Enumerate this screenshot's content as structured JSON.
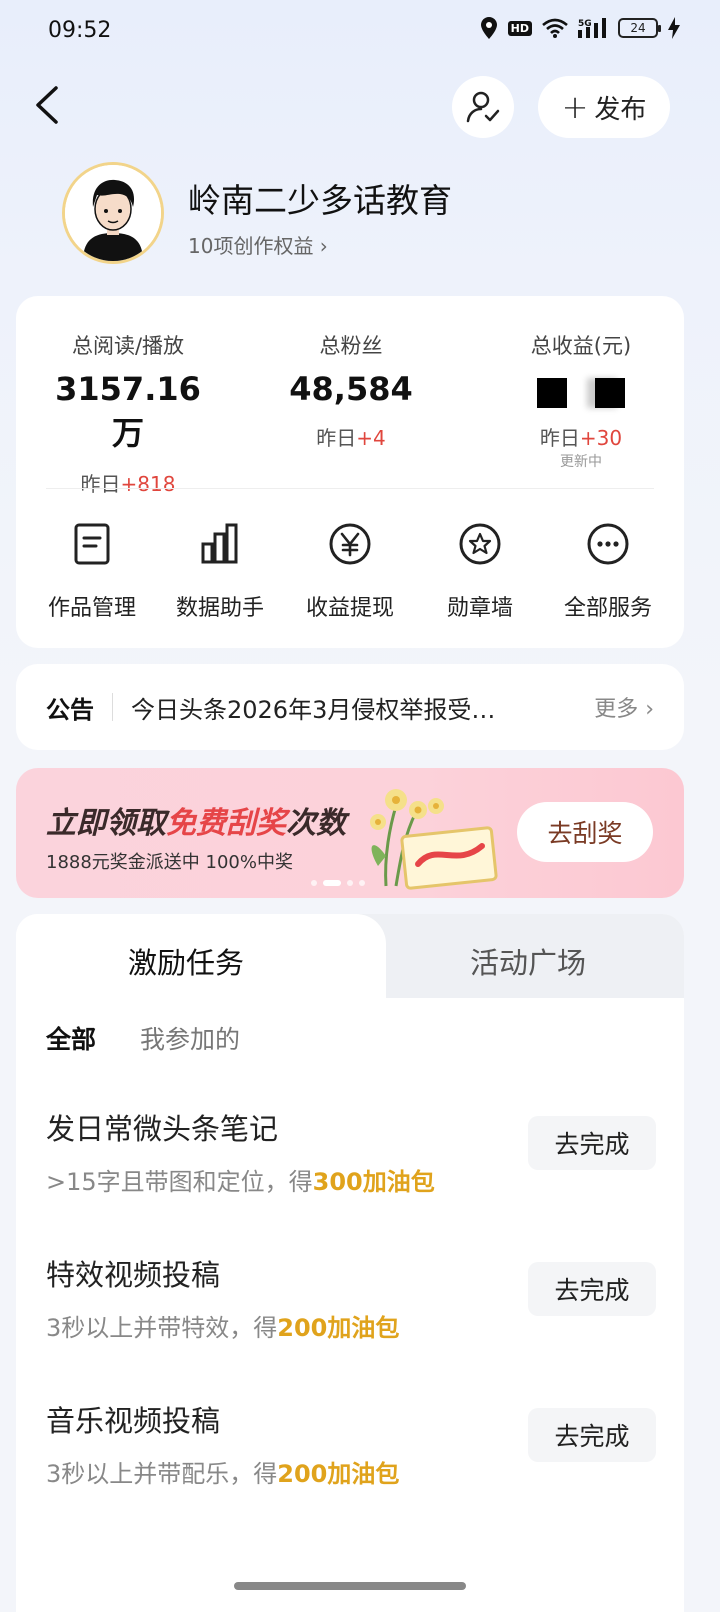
{
  "status_bar": {
    "time": "09:52",
    "hd": "HD",
    "signal": "5G",
    "battery": "24"
  },
  "header": {
    "publish_label": "发布"
  },
  "profile": {
    "name": "岭南二少多话教育",
    "rights": "10项创作权益 ›"
  },
  "stats": [
    {
      "label": "总阅读/播放",
      "value": "3157.16万",
      "delta_prefix": "昨日",
      "delta": "+818"
    },
    {
      "label": "总粉丝",
      "value": "48,584",
      "delta_prefix": "昨日",
      "delta": "+4"
    },
    {
      "label": "总收益(元)",
      "value": "",
      "delta_prefix": "昨日",
      "delta": "+30",
      "note": "更新中"
    }
  ],
  "services": [
    {
      "label": "作品管理",
      "icon": "document-icon"
    },
    {
      "label": "数据助手",
      "icon": "bar-chart-icon"
    },
    {
      "label": "收益提现",
      "icon": "yen-icon"
    },
    {
      "label": "勋章墙",
      "icon": "medal-icon"
    },
    {
      "label": "全部服务",
      "icon": "more-icon"
    }
  ],
  "notice": {
    "tag": "公告",
    "text": "今日头条2026年3月侵权举报受…",
    "more": "更多 ›"
  },
  "banner": {
    "title_a": "立即领取",
    "title_b": "免费刮奖",
    "title_c": "次数",
    "subtitle": "1888元奖金派送中 100%中奖",
    "button": "去刮奖"
  },
  "tasks": {
    "tabs": [
      "激励任务",
      "活动广场"
    ],
    "filters": [
      "全部",
      "我参加的"
    ],
    "items": [
      {
        "title": "发日常微头条笔记",
        "desc": ">15字且带图和定位，得",
        "reward": "300加油包",
        "button": "去完成"
      },
      {
        "title": "特效视频投稿",
        "desc": "3秒以上并带特效，得",
        "reward": "200加油包",
        "button": "去完成"
      },
      {
        "title": "音乐视频投稿",
        "desc": "3秒以上并带配乐，得",
        "reward": "200加油包",
        "button": "去完成"
      }
    ]
  },
  "colors": {
    "accent_red": "#e0463d",
    "reward_gold": "#e0a31c",
    "banner_pink": "#fcd2da"
  }
}
